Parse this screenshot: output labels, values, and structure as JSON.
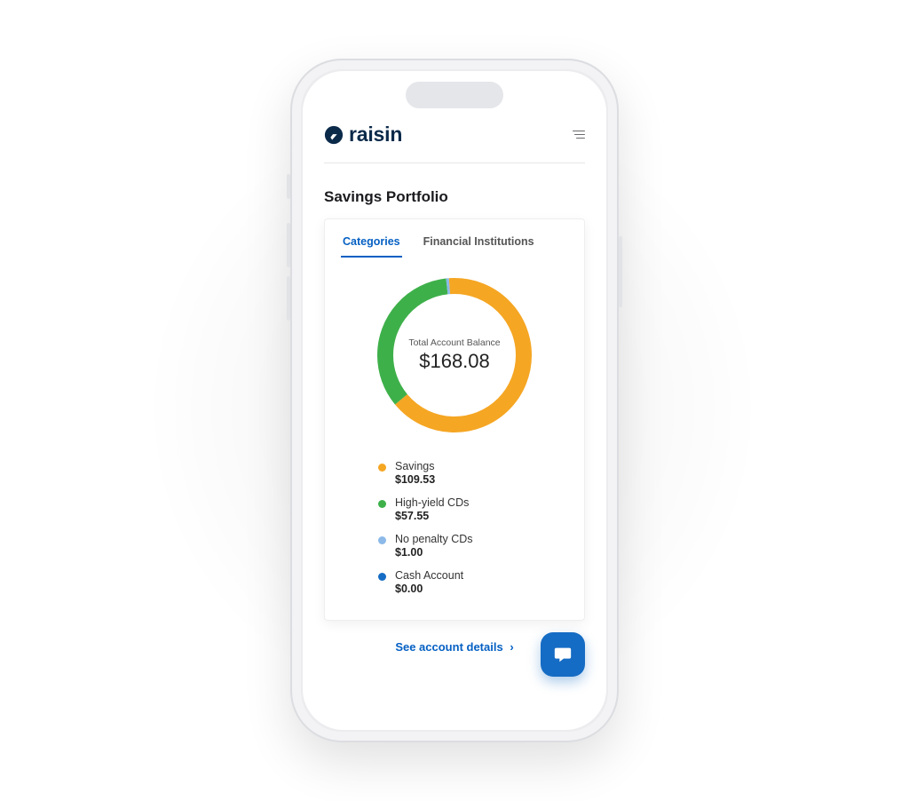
{
  "brand": {
    "name": "raisin"
  },
  "page_title": "Savings Portfolio",
  "tabs": [
    {
      "label": "Categories",
      "active": true
    },
    {
      "label": "Financial Institutions",
      "active": false
    }
  ],
  "total_balance_label": "Total Account Balance",
  "total_balance_value": "$168.08",
  "legend": [
    {
      "label": "Savings",
      "value": "$109.53",
      "color": "#f5a623",
      "num": 109.53
    },
    {
      "label": "High-yield CDs",
      "value": "$57.55",
      "color": "#3eb04a",
      "num": 57.55
    },
    {
      "label": "No penalty CDs",
      "value": "$1.00",
      "color": "#8cb9e8",
      "num": 1.0
    },
    {
      "label": "Cash Account",
      "value": "$0.00",
      "color": "#156cc4",
      "num": 0.0
    }
  ],
  "details_link": "See account details",
  "chart_data": {
    "type": "pie",
    "title": "Total Account Balance",
    "total": 168.08,
    "series": [
      {
        "name": "Savings",
        "value": 109.53,
        "color": "#f5a623"
      },
      {
        "name": "High-yield CDs",
        "value": 57.55,
        "color": "#3eb04a"
      },
      {
        "name": "No penalty CDs",
        "value": 1.0,
        "color": "#8cb9e8"
      },
      {
        "name": "Cash Account",
        "value": 0.0,
        "color": "#156cc4"
      }
    ]
  }
}
